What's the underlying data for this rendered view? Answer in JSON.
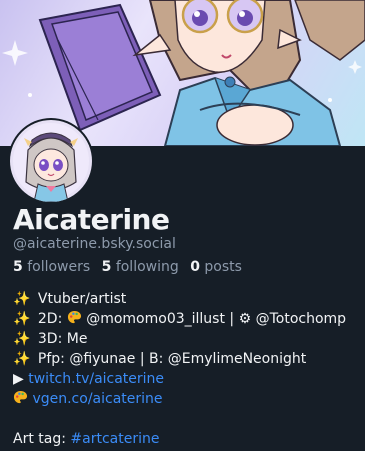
{
  "profile": {
    "display_name": "Aicaterine",
    "handle": "@aicaterine.bsky.social",
    "followers_count": "5",
    "followers_label": "followers",
    "following_count": "5",
    "following_label": "following",
    "posts_count": "0",
    "posts_label": "posts"
  },
  "bio": {
    "line1": "Vtuber/artist",
    "line2_prefix": "2D:",
    "line2_mention1": "@momomo03_illust",
    "line2_sep": "|",
    "line2_mention2": "@Totochomp",
    "line3": "3D: Me",
    "line4_prefix": "Pfp:",
    "line4_mention1": "@fiyunae",
    "line4_sep": "| B:",
    "line4_mention2": "@EmylimeNeonight",
    "link1": "twitch.tv/aicaterine",
    "link2": "vgen.co/aicaterine",
    "art_tag_label": "Art tag:",
    "art_tag": "#artcaterine"
  },
  "icons": {
    "sparkle": "sparkles-icon",
    "palette": "palette-icon",
    "gear": "gear-icon",
    "play": "play-icon"
  },
  "colors": {
    "background": "#161e27",
    "text": "#f1f3f5",
    "muted": "#8d9aab",
    "link": "#3b8cf7"
  }
}
